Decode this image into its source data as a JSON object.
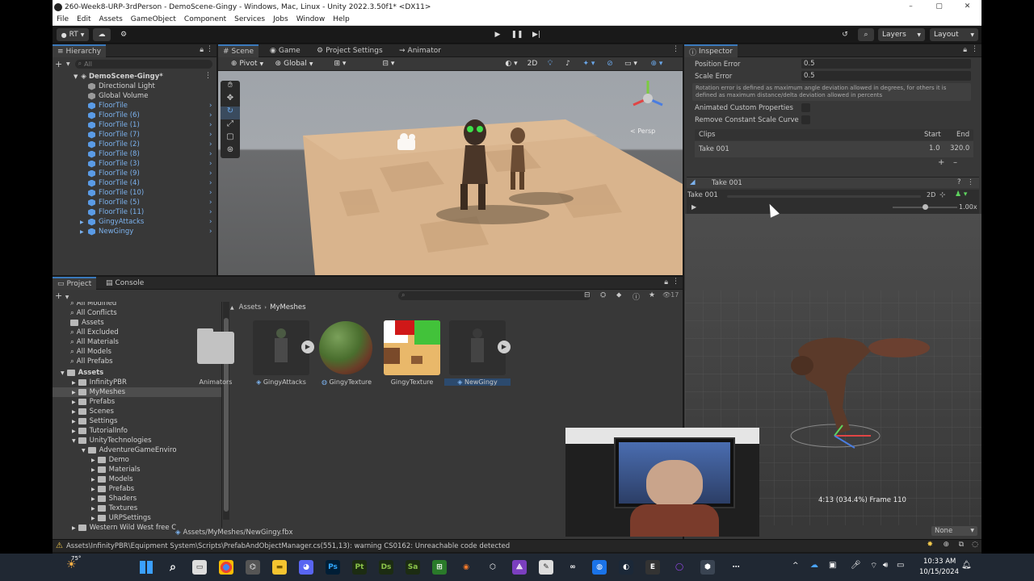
{
  "window": {
    "title": "260-Week8-URP-3rdPerson - DemoScene-Gingy - Windows, Mac, Linux - Unity 2022.3.50f1* <DX11>",
    "controls": [
      "–",
      "▢",
      "✕"
    ]
  },
  "menu": [
    "File",
    "Edit",
    "Assets",
    "GameObject",
    "Component",
    "Services",
    "Jobs",
    "Window",
    "Help"
  ],
  "toolbar": {
    "account": "RT",
    "layers": "Layers",
    "layout": "Layout"
  },
  "hierarchy": {
    "tab": "Hierarchy",
    "search_placeholder": "All",
    "scene": "DemoScene-Gingy*",
    "items": [
      {
        "label": "Directional Light",
        "blue": false
      },
      {
        "label": "Global Volume",
        "blue": false
      },
      {
        "label": "FloorTile",
        "blue": true
      },
      {
        "label": "FloorTile (6)",
        "blue": true
      },
      {
        "label": "FloorTile (1)",
        "blue": true
      },
      {
        "label": "FloorTile (7)",
        "blue": true
      },
      {
        "label": "FloorTile (2)",
        "blue": true
      },
      {
        "label": "FloorTile (8)",
        "blue": true
      },
      {
        "label": "FloorTile (3)",
        "blue": true
      },
      {
        "label": "FloorTile (9)",
        "blue": true
      },
      {
        "label": "FloorTile (4)",
        "blue": true
      },
      {
        "label": "FloorTile (10)",
        "blue": true
      },
      {
        "label": "FloorTile (5)",
        "blue": true
      },
      {
        "label": "FloorTile (11)",
        "blue": true
      },
      {
        "label": "GingyAttacks",
        "blue": true
      },
      {
        "label": "NewGingy",
        "blue": true
      }
    ]
  },
  "center_tabs": [
    "Scene",
    "Game",
    "Project Settings",
    "Animator"
  ],
  "scene_toolbar": {
    "pivot": "Pivot",
    "global": "Global",
    "mode_2d": "2D",
    "persp": "< Persp"
  },
  "project": {
    "tabs": [
      "Project",
      "Console"
    ],
    "count": "17",
    "favorites": [
      "All Modified",
      "All Conflicts",
      "Assets",
      "All Excluded",
      "All Materials",
      "All Models",
      "All Prefabs"
    ],
    "tree_root": "Assets",
    "tree": [
      "InfinityPBR",
      "MyMeshes",
      "Prefabs",
      "Scenes",
      "Settings",
      "TutorialInfo",
      "UnityTechnologies"
    ],
    "adventure": "AdventureGameEnviro",
    "adventure_children": [
      "Demo",
      "Materials",
      "Models",
      "Prefabs",
      "Shaders",
      "Textures",
      "URPSettings"
    ],
    "western": "Western Wild West free C",
    "breadcrumb": [
      "Assets",
      "MyMeshes"
    ],
    "assets": [
      "Animators",
      "GingyAttacks",
      "GingyTexture",
      "GingyTexture",
      "NewGingy"
    ],
    "selected_path": "Assets/MyMeshes/NewGingy.fbx"
  },
  "inspector": {
    "tab": "Inspector",
    "position_error_label": "Position Error",
    "position_error": "0.5",
    "scale_error_label": "Scale Error",
    "scale_error": "0.5",
    "help": "Rotation error is defined as maximum angle deviation allowed in degrees, for others it is defined as maximum distance/delta deviation allowed in percents",
    "animated_custom": "Animated Custom Properties",
    "remove_constant": "Remove Constant Scale Curve",
    "clips_label": "Clips",
    "start_label": "Start",
    "end_label": "End",
    "clip_name": "Take 001",
    "clip_start": "1.0",
    "clip_end": "320.0",
    "clip_header": "Take 001",
    "preview_name": "Take 001",
    "mode_2d": "2D",
    "speed": "1.00x",
    "frame_info": "4:13 (034.4%) Frame 110",
    "bottom_select": "None"
  },
  "status": {
    "warning": "Assets\\InfinityPBR\\Equipment System\\Scripts\\PrefabAndObjectManager.cs(551,13): warning CS0162: Unreachable code detected"
  },
  "taskbar": {
    "temp": "75°",
    "time": "10:33 AM",
    "date": "10/15/2024",
    "apps": [
      "Ps",
      "Pt",
      "Ds",
      "Sa",
      "Ae"
    ]
  },
  "colors": {
    "accent": "#3a79bb",
    "panel": "#383838",
    "blue_item": "#7cb2ee",
    "warning": "#f2c94c"
  }
}
